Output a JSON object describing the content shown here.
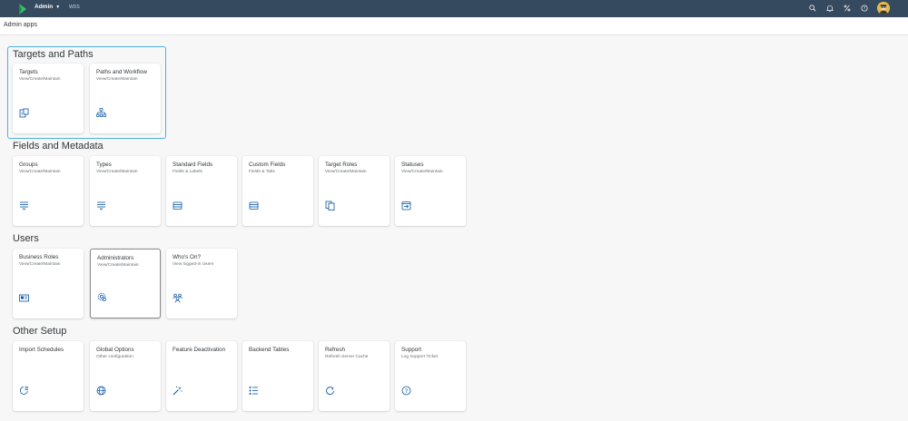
{
  "shell": {
    "app_title": "Admin",
    "system_label": "WDS",
    "colors": {
      "bar": "#354a5f",
      "logo": "#2ec46e"
    },
    "icons": [
      "search-icon",
      "bell-icon",
      "percent-icon",
      "help-icon",
      "avatar"
    ]
  },
  "subheader": {
    "title": "Admin apps"
  },
  "sections": [
    {
      "title": "Targets and Paths",
      "tiles": [
        {
          "title": "Targets",
          "subtitle": "View/Create/Maintain",
          "icon": "targets-icon"
        },
        {
          "title": "Paths and Workflow",
          "subtitle": "View/Create/Maintain",
          "icon": "hierarchy-icon"
        }
      ]
    },
    {
      "title": "Fields and Metadata",
      "tiles": [
        {
          "title": "Groups",
          "subtitle": "View/Create/Maintain",
          "icon": "list-down-icon"
        },
        {
          "title": "Types",
          "subtitle": "View/Create/Maintain",
          "icon": "list-down-icon"
        },
        {
          "title": "Standard Fields",
          "subtitle": "Fields & Labels",
          "icon": "fields-icon"
        },
        {
          "title": "Custom Fields",
          "subtitle": "Fields & Tabs",
          "icon": "fields-icon"
        },
        {
          "title": "Target Roles",
          "subtitle": "View/Create/Maintain",
          "icon": "copy-icon"
        },
        {
          "title": "Statuses",
          "subtitle": "View/Create/Maintain",
          "icon": "calendar-arrow-icon"
        }
      ]
    },
    {
      "title": "Users",
      "tiles": [
        {
          "title": "Business Roles",
          "subtitle": "View/Create/Maintain",
          "icon": "id-card-icon"
        },
        {
          "title": "Administrators",
          "subtitle": "View/Create/Maintain",
          "icon": "admin-gear-icon"
        },
        {
          "title": "Who's On?",
          "subtitle": "View logged-in Users",
          "icon": "group-icon"
        }
      ]
    },
    {
      "title": "Other Setup",
      "tiles": [
        {
          "title": "Import Schedules",
          "subtitle": "",
          "icon": "schedule-icon"
        },
        {
          "title": "Global Options",
          "subtitle": "Other configuration",
          "icon": "globe-icon"
        },
        {
          "title": "Feature Deactivation",
          "subtitle": "",
          "icon": "wand-icon"
        },
        {
          "title": "Backend Tables",
          "subtitle": "",
          "icon": "bullet-list-icon"
        },
        {
          "title": "Refresh",
          "subtitle": "Refresh Server Cache",
          "icon": "refresh-icon"
        },
        {
          "title": "Support",
          "subtitle": "Log Support Ticket",
          "icon": "help-icon"
        }
      ]
    }
  ]
}
